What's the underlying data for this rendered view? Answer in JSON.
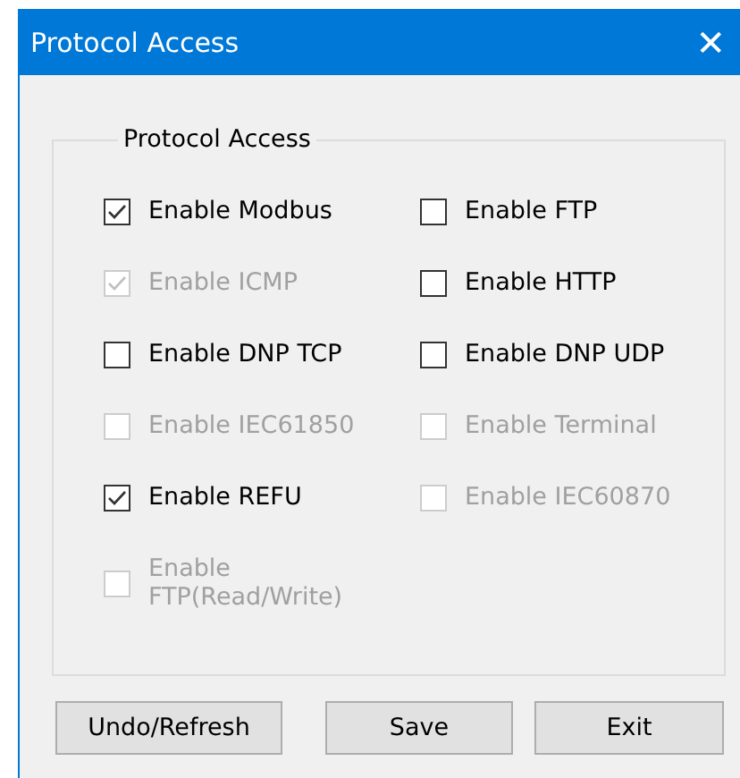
{
  "window": {
    "title": "Protocol Access",
    "close": "✕"
  },
  "group": {
    "title": "Protocol Access",
    "options": [
      {
        "label": "Enable Modbus",
        "checked": true,
        "disabled": false
      },
      {
        "label": "Enable FTP",
        "checked": false,
        "disabled": false
      },
      {
        "label": "Enable ICMP",
        "checked": true,
        "disabled": true
      },
      {
        "label": "Enable HTTP",
        "checked": false,
        "disabled": false
      },
      {
        "label": "Enable DNP TCP",
        "checked": false,
        "disabled": false
      },
      {
        "label": "Enable DNP UDP",
        "checked": false,
        "disabled": false
      },
      {
        "label": "Enable IEC61850",
        "checked": false,
        "disabled": true
      },
      {
        "label": "Enable Terminal",
        "checked": false,
        "disabled": true
      },
      {
        "label": "Enable REFU",
        "checked": true,
        "disabled": false
      },
      {
        "label": "Enable IEC60870",
        "checked": false,
        "disabled": true
      },
      {
        "label": "Enable FTP(Read/Write)",
        "checked": false,
        "disabled": true
      }
    ]
  },
  "buttons": [
    "Undo/Refresh",
    "Save",
    "Exit"
  ]
}
